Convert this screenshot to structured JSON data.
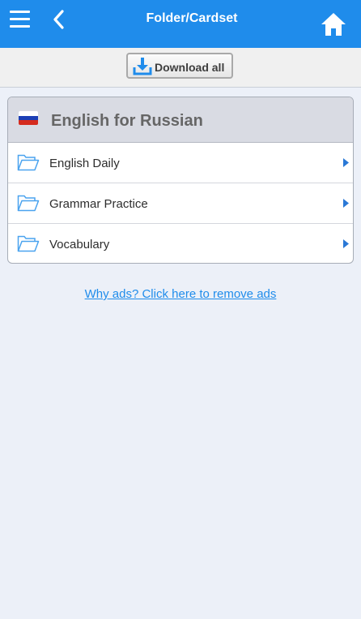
{
  "header": {
    "title": "Folder/Cardset",
    "menu_icon": "hamburger-menu-icon",
    "back_icon": "chevron-left-icon",
    "home_icon": "home-icon",
    "background_color": "#1f8ceb"
  },
  "toolbar": {
    "download_label": "Download all",
    "download_icon": "download-icon"
  },
  "folder": {
    "title": "English for Russian",
    "flag_icon": "russia-flag-icon",
    "items": [
      {
        "label": "English Daily",
        "icon": "folder-open-icon"
      },
      {
        "label": "Grammar Practice",
        "icon": "folder-open-icon"
      },
      {
        "label": "Vocabulary",
        "icon": "folder-open-icon"
      }
    ]
  },
  "ads_link": "Why ads? Click here to remove ads"
}
